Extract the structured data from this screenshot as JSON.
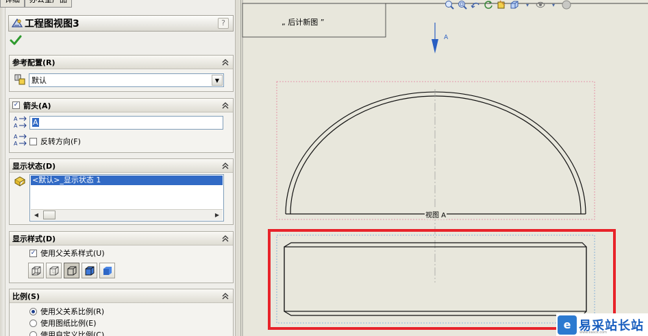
{
  "top_tabs": [
    "详细",
    "办公室产品"
  ],
  "panel": {
    "title": "工程图视图3",
    "help_label": "?"
  },
  "ref_config": {
    "header": "参考配置(R)",
    "value": "默认"
  },
  "arrow": {
    "header": "箭头(A)",
    "label_value": "A",
    "reverse_label": "反转方向(F)"
  },
  "display_state": {
    "header": "显示状态(D)",
    "selected_item": "<默认>_显示状态 1"
  },
  "display_style": {
    "header": "显示样式(D)",
    "use_parent_label": "使用父关系样式(U)"
  },
  "scale": {
    "header": "比例(S)",
    "options": [
      "使用父关系比例(R)",
      "使用图纸比例(E)",
      "使用自定义比例(C)"
    ]
  },
  "drawing": {
    "note_text": "„ 后计新图 ”",
    "arrow_label": "A",
    "view_label": "视图 A"
  },
  "watermark": {
    "logo_letter": "e",
    "text": "易采站长站",
    "subtext": "www.easck.com"
  },
  "colors": {
    "highlight_red": "#e8232a",
    "selection_blue": "#316ac5",
    "accent_green": "#2e9a2e"
  }
}
